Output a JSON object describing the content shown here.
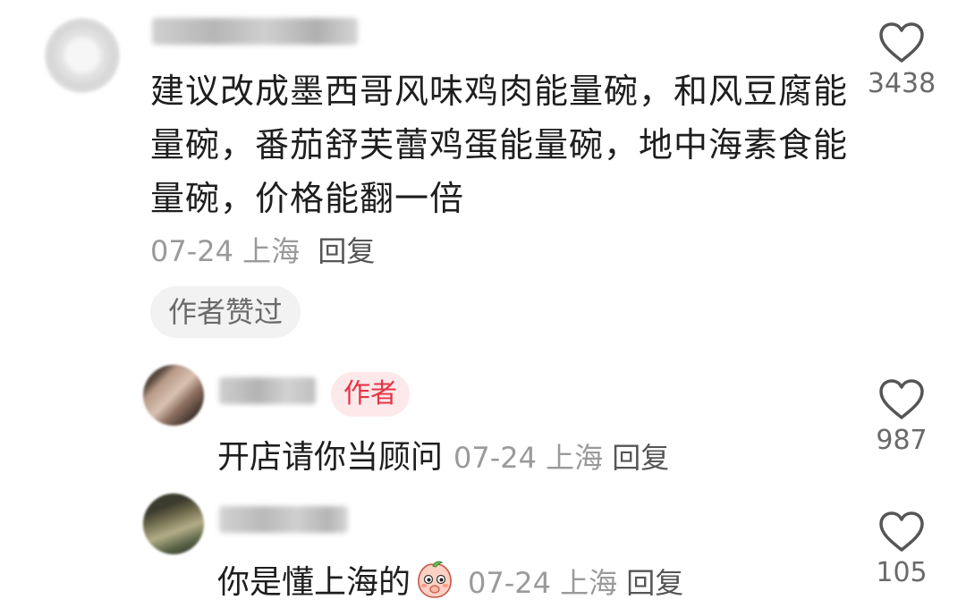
{
  "main_comment": {
    "text": "建议改成墨西哥风味鸡肉能量碗，和风豆腐能量碗，番茄舒芙蕾鸡蛋能量碗，地中海素食能量碗，价格能翻一倍",
    "date": "07-24",
    "location": "上海",
    "reply_label": "回复",
    "liked_badge": "作者赞过",
    "like_count": "3438"
  },
  "replies": [
    {
      "author_tag": "作者",
      "text": "开店请你当顾问",
      "date": "07-24",
      "location": "上海",
      "reply_label": "回复",
      "like_count": "987"
    },
    {
      "text": "你是懂上海的",
      "emoji": "peach-face-emoji",
      "date": "07-24",
      "location": "上海",
      "reply_label": "回复",
      "like_count": "105"
    }
  ],
  "icons": {
    "like": "heart-outline-icon"
  },
  "colors": {
    "author_tag_text": "#e53446",
    "author_tag_bg": "#fde8ea",
    "meta_text": "#9a9a9a"
  }
}
